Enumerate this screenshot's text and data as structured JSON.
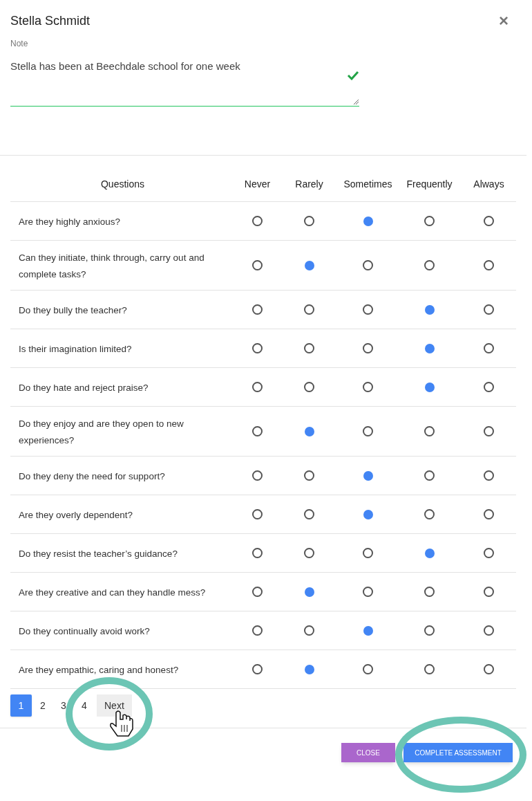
{
  "dialog": {
    "title": "Stella Schmidt",
    "close_icon": "×"
  },
  "note": {
    "label": "Note",
    "value": "Stella has been at Beechdale school for one week",
    "valid": true
  },
  "table": {
    "columns": [
      "Questions",
      "Never",
      "Rarely",
      "Sometimes",
      "Frequently",
      "Always"
    ],
    "rows": [
      {
        "question": "Are they highly anxious?",
        "choices": [
          {
            "selected": false
          },
          {
            "selected": false
          },
          {
            "selected": true
          },
          {
            "selected": false
          },
          {
            "selected": false
          }
        ]
      },
      {
        "question": "Can they initiate, think through, carry out and complete tasks?",
        "choices": [
          {
            "selected": false
          },
          {
            "selected": true
          },
          {
            "selected": false
          },
          {
            "selected": false
          },
          {
            "selected": false
          }
        ]
      },
      {
        "question": "Do they bully the teacher?",
        "choices": [
          {
            "selected": false
          },
          {
            "selected": false
          },
          {
            "selected": false
          },
          {
            "selected": true
          },
          {
            "selected": false
          }
        ]
      },
      {
        "question": "Is their imagination limited?",
        "choices": [
          {
            "selected": false
          },
          {
            "selected": false
          },
          {
            "selected": false
          },
          {
            "selected": true
          },
          {
            "selected": false
          }
        ]
      },
      {
        "question": "Do they hate and reject praise?",
        "choices": [
          {
            "selected": false
          },
          {
            "selected": false
          },
          {
            "selected": false
          },
          {
            "selected": true
          },
          {
            "selected": false
          }
        ]
      },
      {
        "question": "Do they enjoy and are they open to new experiences?",
        "choices": [
          {
            "selected": false
          },
          {
            "selected": true
          },
          {
            "selected": false
          },
          {
            "selected": false
          },
          {
            "selected": false
          }
        ]
      },
      {
        "question": "Do they deny the need for support?",
        "choices": [
          {
            "selected": false
          },
          {
            "selected": false
          },
          {
            "selected": true
          },
          {
            "selected": false
          },
          {
            "selected": false
          }
        ]
      },
      {
        "question": "Are they overly dependent?",
        "choices": [
          {
            "selected": false
          },
          {
            "selected": false
          },
          {
            "selected": true
          },
          {
            "selected": false
          },
          {
            "selected": false
          }
        ]
      },
      {
        "question": "Do they resist the teacher’s guidance?",
        "choices": [
          {
            "selected": false
          },
          {
            "selected": false
          },
          {
            "selected": false
          },
          {
            "selected": true
          },
          {
            "selected": false
          }
        ]
      },
      {
        "question": "Are they creative and can they handle mess?",
        "choices": [
          {
            "selected": false
          },
          {
            "selected": true
          },
          {
            "selected": false
          },
          {
            "selected": false
          },
          {
            "selected": false
          }
        ]
      },
      {
        "question": "Do they continually avoid work?",
        "choices": [
          {
            "selected": false
          },
          {
            "selected": false
          },
          {
            "selected": true
          },
          {
            "selected": false
          },
          {
            "selected": false
          }
        ]
      },
      {
        "question": "Are they empathic, caring and honest?",
        "choices": [
          {
            "selected": false
          },
          {
            "selected": true
          },
          {
            "selected": false
          },
          {
            "selected": false
          },
          {
            "selected": false
          }
        ]
      }
    ]
  },
  "pagination": {
    "pages": [
      {
        "label": "1",
        "selected": true
      },
      {
        "label": "2",
        "selected": false
      },
      {
        "label": "3",
        "selected": false
      },
      {
        "label": "4",
        "selected": false
      }
    ],
    "next": "Next"
  },
  "buttons": [
    {
      "label": "CLOSE",
      "kind": "secondary"
    },
    {
      "label": "COMPLETE ASSESSMENT",
      "kind": "primary"
    }
  ]
}
